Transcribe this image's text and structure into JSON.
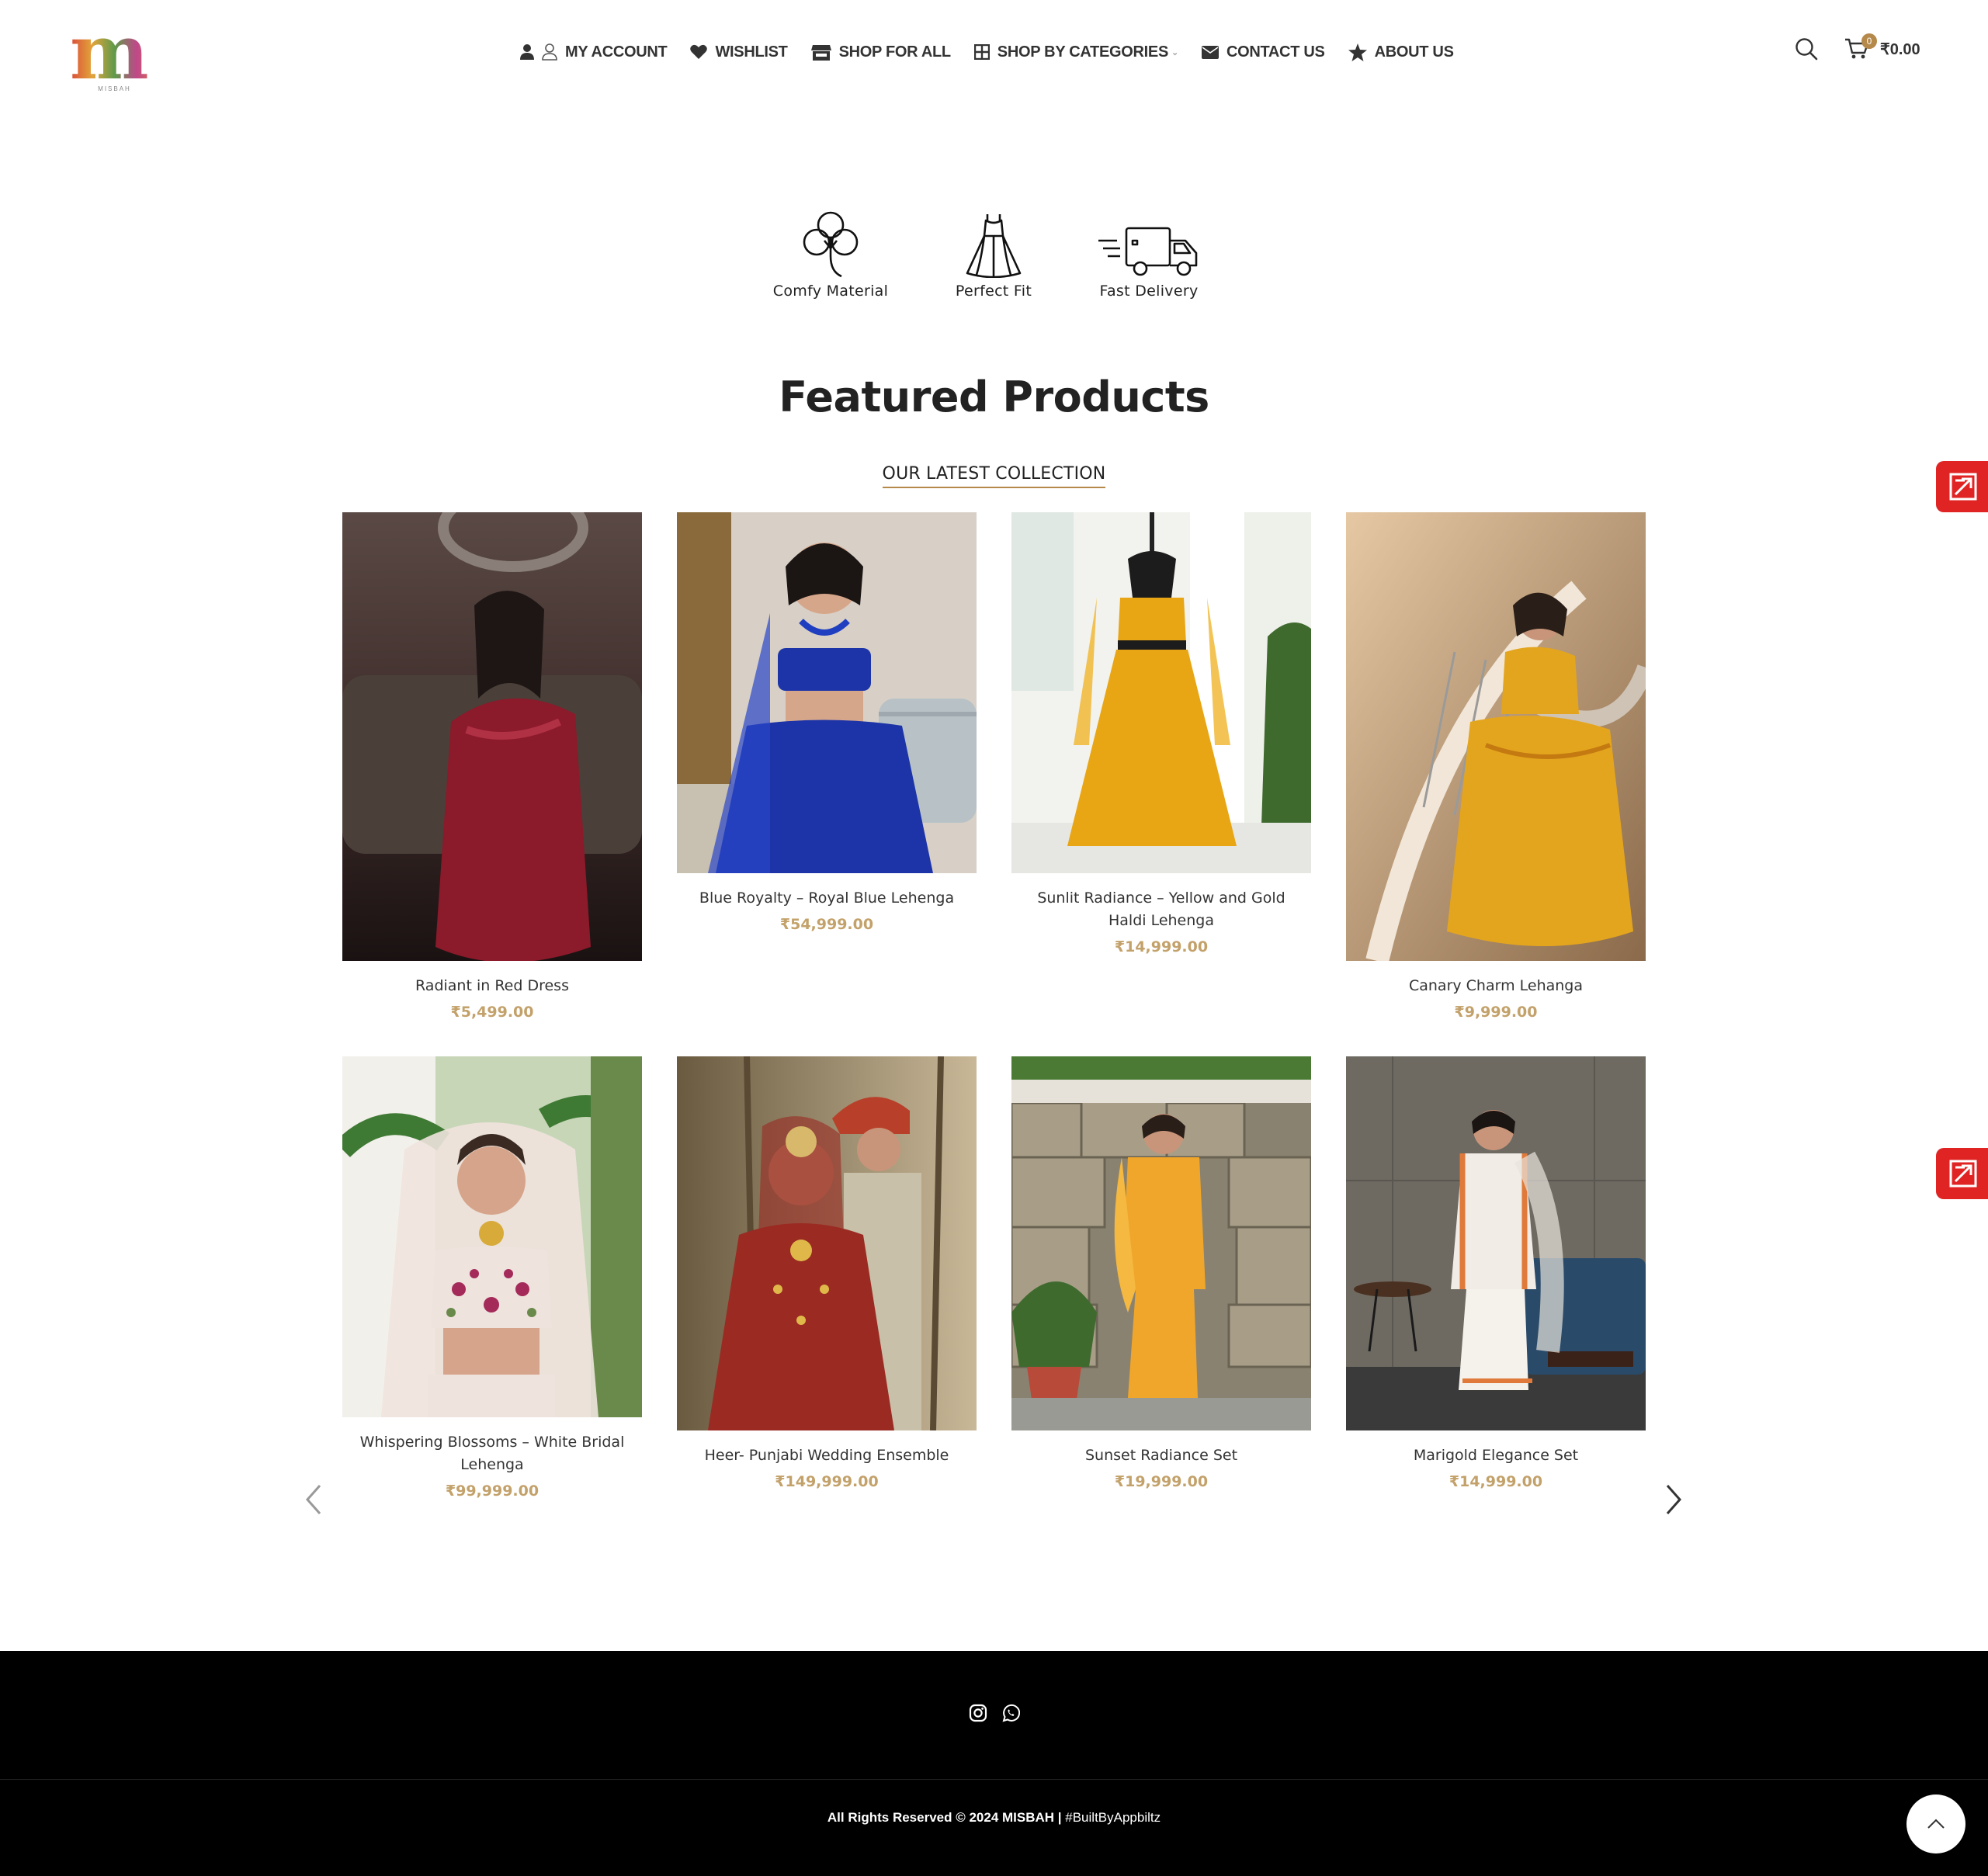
{
  "brand": {
    "logo_letter": "m",
    "logo_sub": "MISBAH"
  },
  "nav": {
    "items": [
      {
        "label": "MY ACCOUNT",
        "icon": "user-icon"
      },
      {
        "label": "WISHLIST",
        "icon": "heart-icon"
      },
      {
        "label": "SHOP FOR ALL",
        "icon": "store-icon"
      },
      {
        "label": "SHOP BY CATEGORIES",
        "icon": "grid-icon"
      },
      {
        "label": "CONTACT US",
        "icon": "envelope-icon"
      },
      {
        "label": "ABOUT US",
        "icon": "star-icon"
      }
    ]
  },
  "cart": {
    "count": "0",
    "total": "₹0.00"
  },
  "features": [
    {
      "label": "Comfy  Material",
      "icon": "cotton-icon"
    },
    {
      "label": "Perfect  Fit",
      "icon": "dress-icon"
    },
    {
      "label": "Fast  Delivery",
      "icon": "truck-icon"
    }
  ],
  "section": {
    "title": "Featured Products",
    "subtitle": "OUR LATEST COLLECTION"
  },
  "products": [
    {
      "name": "Radiant in Red Dress",
      "price": "₹5,499.00",
      "colors": [
        "#3b2a28",
        "#8b1a2a"
      ]
    },
    {
      "name": "Blue Royalty – Royal Blue Lehenga",
      "price": "₹54,999.00",
      "colors": [
        "#cfc7bd",
        "#1c34a8"
      ]
    },
    {
      "name": "Sunlit Radiance – Yellow and Gold Haldi Lehenga",
      "price": "₹14,999.00",
      "colors": [
        "#f2f2ee",
        "#e8a514"
      ]
    },
    {
      "name": "Canary Charm Lehanga",
      "price": "₹9,999.00",
      "colors": [
        "#c89a6a",
        "#e4a51e"
      ]
    },
    {
      "name": "Whispering Blossoms – White Bridal Lehenga",
      "price": "₹99,999.00",
      "colors": [
        "#8fae6a",
        "#efe3de"
      ]
    },
    {
      "name": "Heer- Punjabi Wedding Ensemble",
      "price": "₹149,999.00",
      "colors": [
        "#a89a78",
        "#9a2a22"
      ]
    },
    {
      "name": "Sunset Radiance Set",
      "price": "₹19,999.00",
      "colors": [
        "#8a8270",
        "#f0a62a"
      ]
    },
    {
      "name": "Marigold Elegance Set",
      "price": "₹14,999.00",
      "colors": [
        "#5e5d58",
        "#f1ece6"
      ]
    }
  ],
  "footer": {
    "social": [
      "instagram-icon",
      "whatsapp-icon"
    ],
    "copyright_main": "All Rights Reserved © 2024 MISBAH | ",
    "copyright_tag": "#BuiltByAppbiltz"
  }
}
